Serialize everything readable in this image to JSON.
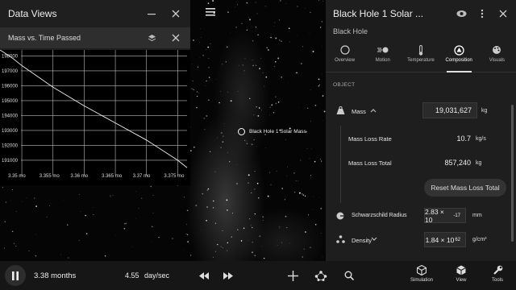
{
  "data_views": {
    "title": "Data Views",
    "chart_title": "Mass vs. Time Passed",
    "icons": [
      "minimize-icon",
      "close-icon",
      "layers-icon",
      "close-icon"
    ]
  },
  "chart_data": {
    "type": "line",
    "title": "Mass vs. Time Passed",
    "x_ticks": [
      "3.35 mo",
      "3.355 mo",
      "3.36 mo",
      "3.365 mo",
      "3.37 mo",
      "3.375 mo"
    ],
    "y_ticks": [
      "198000",
      "197000",
      "196000",
      "195000",
      "194000",
      "193000",
      "192000",
      "191000"
    ],
    "ylim": [
      190400,
      198400
    ],
    "xlim": [
      3.3465,
      3.3765
    ],
    "series": [
      {
        "x": [
          3.3465,
          3.3485,
          3.35,
          3.355,
          3.36,
          3.365,
          3.37,
          3.375,
          3.3765
        ],
        "y": [
          198400,
          197850,
          197350,
          195900,
          194650,
          193500,
          192350,
          191000,
          190500
        ]
      }
    ],
    "grid": true
  },
  "canvas": {
    "object_label": "Black Hole 1 Solar Mass"
  },
  "object_panel": {
    "title": "Black Hole 1 Solar ...",
    "subtitle": "Black Hole",
    "tabs": [
      {
        "label": "Overview",
        "icon": "circle-icon"
      },
      {
        "label": "Motion",
        "icon": "motion-icon"
      },
      {
        "label": "Temperature",
        "icon": "thermometer-icon"
      },
      {
        "label": "Composition",
        "icon": "composition-icon",
        "active": true
      },
      {
        "label": "Visuals",
        "icon": "palette-icon"
      }
    ],
    "section": "OBJECT",
    "mass": {
      "label": "Mass",
      "value": "19,031,627",
      "unit": "kg"
    },
    "mass_loss_rate": {
      "label": "Mass Loss Rate",
      "value": "10.7",
      "unit": "kg/s"
    },
    "mass_loss_total": {
      "label": "Mass Loss Total",
      "value": "857,240",
      "unit": "kg"
    },
    "reset_button": "Reset Mass Loss Total",
    "schwarzschild": {
      "label": "Schwarzschild Radius",
      "value": "2.83 × 10",
      "exp": "-17",
      "unit": "mm"
    },
    "density": {
      "label": "Density",
      "value": "1.84 × 10",
      "exp": "62",
      "unit": "g/cm³"
    }
  },
  "bottom_bar": {
    "time": "3.38 months",
    "rate_value": "4.55",
    "rate_unit": "day/sec",
    "buttons": [
      {
        "label": "Simulation",
        "icon": "cube-icon"
      },
      {
        "label": "View",
        "icon": "view-cube-icon"
      },
      {
        "label": "Tools",
        "icon": "wrench-icon"
      }
    ]
  }
}
